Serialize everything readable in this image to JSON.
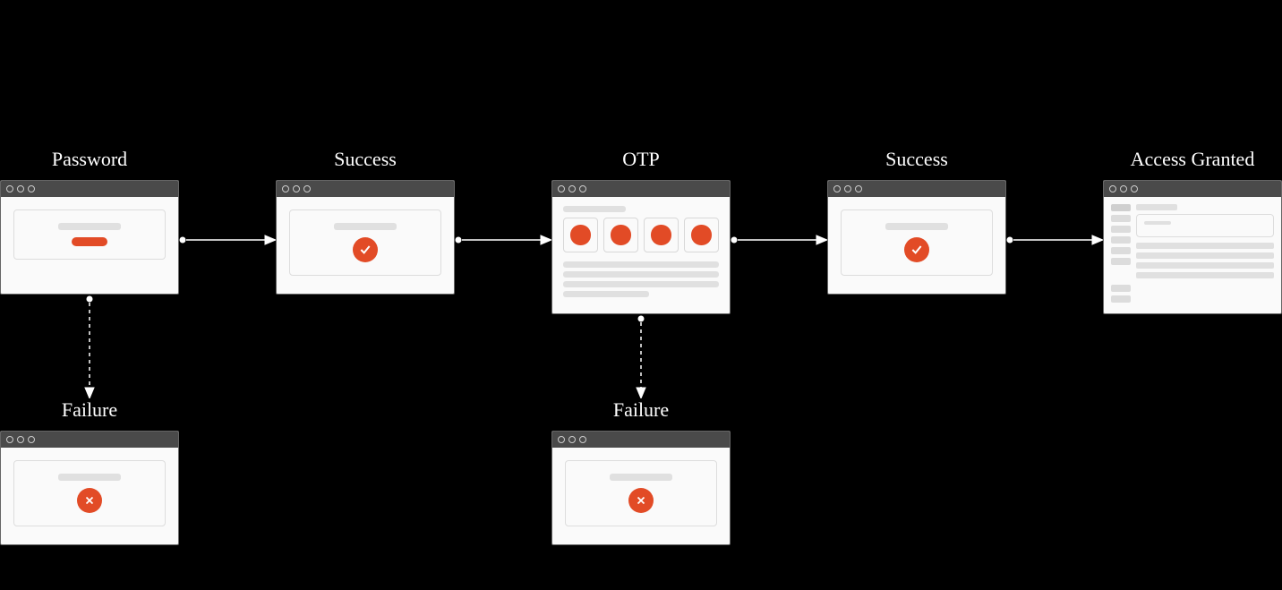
{
  "flow": {
    "password": {
      "label": "Password"
    },
    "success1": {
      "label": "Success"
    },
    "otp": {
      "label": "OTP"
    },
    "success2": {
      "label": "Success"
    },
    "access": {
      "label": "Access Granted"
    },
    "failure1": {
      "label": "Failure"
    },
    "failure2": {
      "label": "Failure"
    }
  },
  "chart_data": {
    "type": "flow",
    "nodes": [
      {
        "id": "password",
        "label": "Password",
        "kind": "step"
      },
      {
        "id": "success1",
        "label": "Success",
        "kind": "outcome-success"
      },
      {
        "id": "otp",
        "label": "OTP",
        "kind": "step"
      },
      {
        "id": "success2",
        "label": "Success",
        "kind": "outcome-success"
      },
      {
        "id": "access",
        "label": "Access Granted",
        "kind": "terminal"
      },
      {
        "id": "failure1",
        "label": "Failure",
        "kind": "outcome-failure"
      },
      {
        "id": "failure2",
        "label": "Failure",
        "kind": "outcome-failure"
      }
    ],
    "edges": [
      {
        "from": "password",
        "to": "success1",
        "style": "solid"
      },
      {
        "from": "success1",
        "to": "otp",
        "style": "solid"
      },
      {
        "from": "otp",
        "to": "success2",
        "style": "solid"
      },
      {
        "from": "success2",
        "to": "access",
        "style": "solid"
      },
      {
        "from": "password",
        "to": "failure1",
        "style": "dashed"
      },
      {
        "from": "otp",
        "to": "failure2",
        "style": "dashed"
      }
    ]
  }
}
